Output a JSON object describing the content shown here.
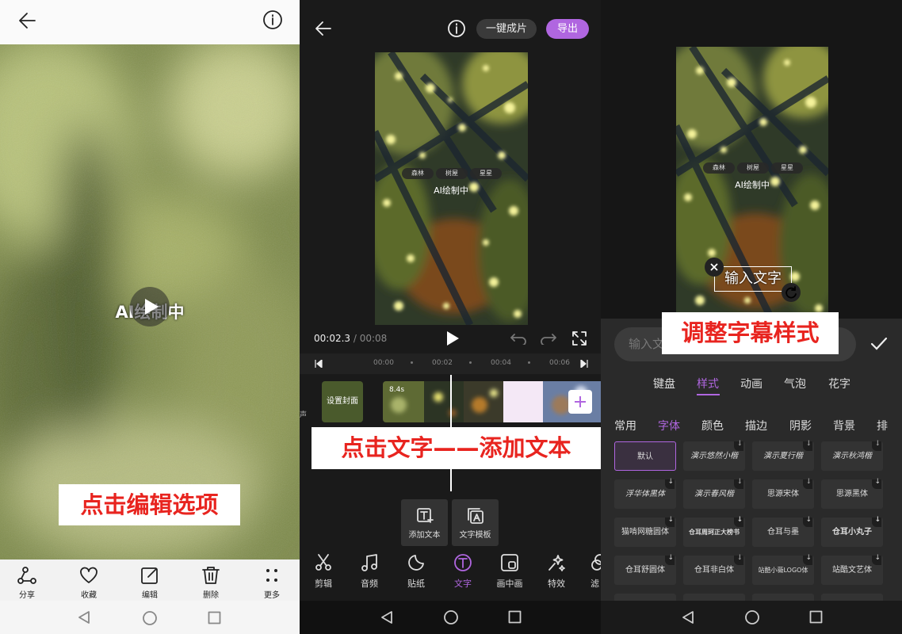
{
  "panel1": {
    "video_overlay_text": "AI绘制中",
    "caption": "点击编辑选项",
    "actions": [
      {
        "label": "分享",
        "icon": "share-icon"
      },
      {
        "label": "收藏",
        "icon": "heart-icon"
      },
      {
        "label": "编辑",
        "icon": "edit-icon"
      },
      {
        "label": "删除",
        "icon": "trash-icon"
      },
      {
        "label": "更多",
        "icon": "more-icon"
      }
    ]
  },
  "panel2": {
    "one_click_label": "一键成片",
    "export_label": "导出",
    "tags": [
      "森林",
      "树屋",
      "星星"
    ],
    "overlay_text": "AI绘制中",
    "time_current": "00:02.3",
    "time_separator": " / ",
    "time_total": "00:08",
    "ruler": [
      "00:00",
      "00:02",
      "00:04",
      "00:06"
    ],
    "cover_label": "设置封面",
    "clip_duration": "8.4s",
    "side_label": "声",
    "caption": "点击文字——添加文本",
    "text_actions": [
      "添加文本",
      "文字模板"
    ],
    "tools": [
      {
        "label": "剪辑",
        "icon": "scissors-icon"
      },
      {
        "label": "音频",
        "icon": "music-icon"
      },
      {
        "label": "贴纸",
        "icon": "sticker-icon"
      },
      {
        "label": "文字",
        "icon": "text-icon"
      },
      {
        "label": "画中画",
        "icon": "pip-icon"
      },
      {
        "label": "特效",
        "icon": "effects-icon"
      },
      {
        "label": "滤",
        "icon": "filter-icon"
      }
    ],
    "accent": "#b066e0"
  },
  "panel3": {
    "tags": [
      "森林",
      "树屋",
      "星星"
    ],
    "overlay_text": "AI绘制中",
    "text_box": "输入文字",
    "input_placeholder": "输入文",
    "caption": "调整字幕样式",
    "main_tabs": [
      "键盘",
      "样式",
      "动画",
      "气泡",
      "花字"
    ],
    "main_tab_active": "样式",
    "sub_tabs": [
      "常用",
      "字体",
      "颜色",
      "描边",
      "阴影",
      "背景",
      "排"
    ],
    "sub_tab_active": "字体",
    "fonts": [
      [
        "默认",
        "演示悠然小楷",
        "演示夏行楷",
        "演示秋鸿楷"
      ],
      [
        "浮华体黑体",
        "演示春风楷",
        "思源宋体",
        "思源黑体"
      ],
      [
        "猫啃网糖圆体",
        "仓耳周珂正大榜书",
        "仓耳与墨",
        "仓耳小丸子"
      ],
      [
        "仓耳舒圆体",
        "仓耳非白体",
        "站酷小薇LOGO体",
        "站酷文艺体"
      ]
    ],
    "accent": "#b066e0"
  }
}
